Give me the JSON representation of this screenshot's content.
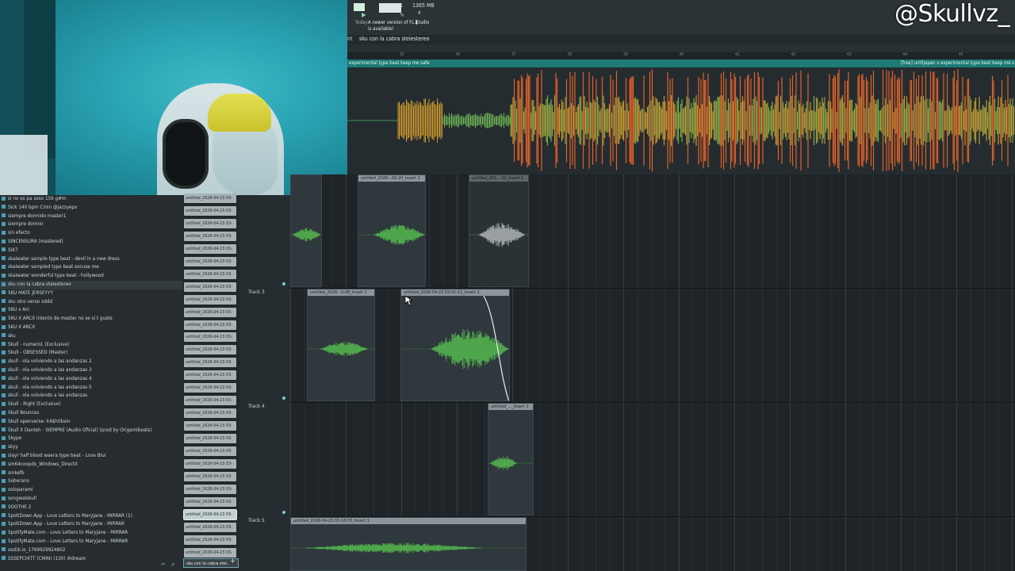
{
  "watermark": "@Skullvz_",
  "toolbar": {
    "channel_num": "31",
    "memory": "1365 MB",
    "volume": "4",
    "update_prefix": "Today",
    "update_notice": "A newer version of FL Studio is available!"
  },
  "titlebar": {
    "left_fragment": "nt",
    "title": "sku con la cabra steiestereo"
  },
  "ruler_ticks": [
    "35",
    "36",
    "37",
    "38",
    "39",
    "40",
    "41",
    "42",
    "43",
    "44",
    "45"
  ],
  "top_clip": {
    "left_label": "experimental type beat keep me safe",
    "right_label": "[free] untiljapan x experimental type beat keep me s"
  },
  "browser": {
    "items": [
      "si no es pa seso 156 g#m",
      "Sick 140 bpm Cmin @jazzyepx",
      "siempre dormido master1",
      "siempre dormio",
      "sin efecto",
      "SINCENSURA (mastered)",
      "SIX7",
      "skaiwater  sample type beat - devil in a new dress",
      "skaiwater sampled type beat excuse me",
      "skaiwater wonderful type beat - hollywood",
      "sku con la cabra steiestereo",
      "SKU MATE JERSEYYY",
      "sku otro verso xddd",
      "SKU x Arc",
      "SKU X ARCX intento de master no se si t guste",
      "SKU X ARCX",
      "sku",
      "Skull - numero1 (Exclusive)",
      "Skull - OBSESSED (Master)",
      "skull - ola volviendo a las andanzas 2",
      "skull - ola volviendo a las andanzas 3",
      "skull - ola volviendo a las andanzas 4",
      "skull - ola volviendo a las andanzas 5",
      "skull - ola volviendo a las andanzas",
      "Skull - Right (Exclusive)",
      "Skull Bounces",
      "Skull openverse- k4$h0bain",
      "Skull X Danteh - SIEMPRE (Audio Oficial) (prod by Origamibeats)",
      "Skype",
      "skyy",
      "slayr  half blood  waera type beat - Love Blur",
      "sm64coopdx_Windows_DirectX",
      "smkefb",
      "Soberano",
      "soloparami",
      "songwalskull",
      "SOOTHE 2",
      "SpotiDown.App - Love Letters to Maryjane - MIRRAR (1)",
      "SpotiDown.App - Love Letters to Maryjane - MIRRAR",
      "SpotifyMate.com - Love Letters to Maryjane - MIRRAR",
      "SpotifyMate.com - Love Letters to Maryjane - MIRRAR",
      "ssstik.io_1769929924802",
      "SSSEPCHITT (CMIN) (130) @dream"
    ],
    "selected_index": 10
  },
  "cliplist": {
    "items": [
      "untitled_2026-04-23 03-",
      "untitled_2026-04-23 03-",
      "untitled_2026-04-23 03-",
      "untitled_2026-04-23 03-",
      "untitled_2026-04-23 03-",
      "untitled_2026-04-23 03-",
      "untitled_2026-04-23 03-",
      "untitled_2026-04-23 03-",
      "untitled_2026-04-23 03-",
      "untitled_2026-04-23 03-",
      "untitled_2026-04-23 03-",
      "untitled_2026-04-23 03-",
      "untitled_2026-04-23 03-",
      "untitled_2026-04-23 03-",
      "untitled_2026-04-23 03-",
      "untitled_2026-04-23 03-",
      "untitled_2026-04-23 03-",
      "untitled_2026-04-23 03-",
      "untitled_2026-04-23 03-",
      "untitled_2026-04-23 03-",
      "untitled_2026-04-23 03-",
      "untitled_2026-04-23 03-",
      "untitled_2026-04-23 03-",
      "untitled_2026-04-23 03-",
      "untitled_2026-04-23 03-",
      "untitled_2026-04-23 03-",
      "untitled_2026-04-23 03-",
      "untitled_2026-04-23 03-",
      "untitled_2026-04-23 03-"
    ],
    "search_value": "sku con la cabra stei.."
  },
  "tracks": [
    {
      "name": "Track 3"
    },
    {
      "name": "Track 4"
    },
    {
      "name": "Track 5"
    }
  ],
  "clips": [
    {
      "label": "untitled_2026-..00-20_Insert 1"
    },
    {
      "label": "untitled_202...-20_Insert 1"
    },
    {
      "label": "untitled_2026-..0-08_Insert 1"
    },
    {
      "label": "untitled_2026-04-23 03-01-12_Insert 1"
    },
    {
      "label": "untitled_..._Insert 1"
    },
    {
      "label": "untitled_2026-04-23 03-18-55_Insert 1"
    }
  ]
}
